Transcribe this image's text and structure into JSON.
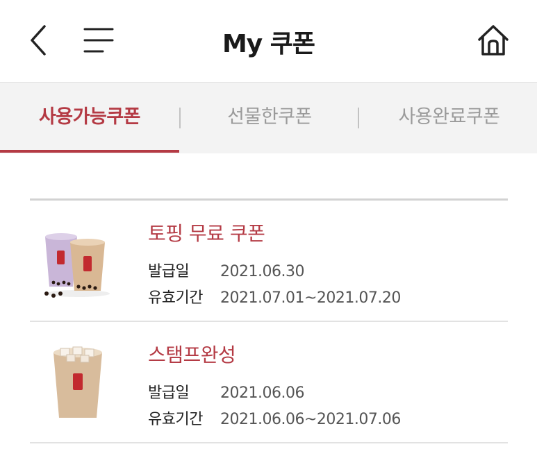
{
  "header": {
    "title": "My 쿠폰",
    "back_icon": "back-arrow-icon",
    "menu_icon": "hamburger-menu-icon",
    "home_icon": "home-icon"
  },
  "tabs": [
    {
      "label": "사용가능쿠폰",
      "active": true
    },
    {
      "label": "선물한쿠폰",
      "active": false
    },
    {
      "label": "사용완료쿠폰",
      "active": false
    }
  ],
  "colors": {
    "accent": "#b43a44",
    "tab_bg": "#f3f3f3",
    "muted": "#9a9a9a"
  },
  "coupons": [
    {
      "title": "토핑 무료 쿠폰",
      "issue_label": "발급일",
      "issue_date": "2021.06.30",
      "valid_label": "유효기간",
      "valid_period": "2021.07.01~2021.07.20"
    },
    {
      "title": "스탬프완성",
      "issue_label": "발급일",
      "issue_date": "2021.06.06",
      "valid_label": "유효기간",
      "valid_period": "2021.06.06~2021.07.06"
    }
  ]
}
